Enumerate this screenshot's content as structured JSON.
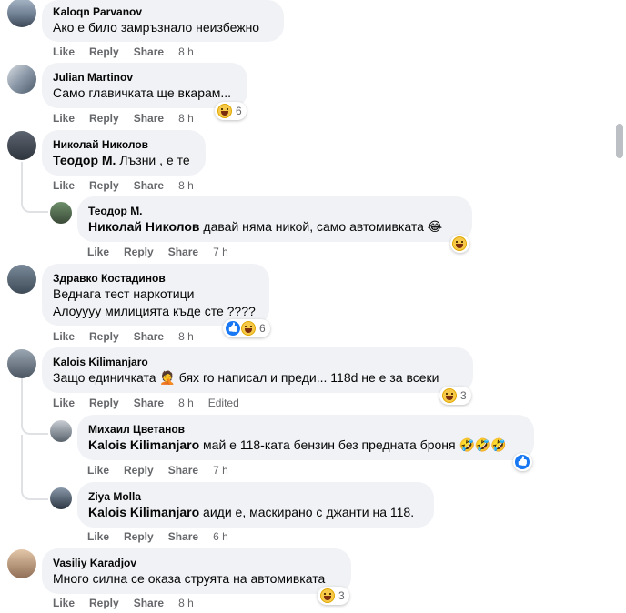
{
  "labels": {
    "like": "Like",
    "reply": "Reply",
    "share": "Share"
  },
  "comments": [
    {
      "author": "Kaloqn Parvanov",
      "text": "Ако е било замръзнало неизбежно",
      "time": "8 h"
    },
    {
      "author": "Julian Martinov",
      "text": "Само главичката ще вкарам...",
      "time": "8 h",
      "reactions": "6"
    },
    {
      "author": "Николай Николов",
      "mention": "Теодор М.",
      "text": " Лъзни , е те",
      "time": "8 h"
    },
    {
      "author": "Теодор М.",
      "mention": "Николай Николов",
      "text": " давай няма никой, само автомивката 😂",
      "time": "7 h"
    },
    {
      "author": "Здравко Костадинов",
      "text_line1": "Веднага тест наркотици",
      "text_line2": "Алоуууу милицията къде сте ????",
      "time": "8 h",
      "reactions": "6"
    },
    {
      "author": "Kalois Kilimanjaro",
      "text": "Защо единичката 🤦 бях го написал и преди... 118d не е за всеки",
      "time": "8 h",
      "edited": "Edited",
      "reactions": "3"
    },
    {
      "author": "Михаил Цветанов",
      "mention": "Kalois Kilimanjaro",
      "text": " май е 118-ката бензин без предната броня 🤣🤣🤣",
      "time": "7 h"
    },
    {
      "author": "Ziya Molla",
      "mention": "Kalois Kilimanjaro",
      "text": " аиди е, маскирано с джанти на 118.",
      "time": "6 h"
    },
    {
      "author": "Vasiliy Karadjov",
      "text": "Много силна се оказа струята на автомивката",
      "time": "8 h",
      "reactions": "3"
    }
  ],
  "colors": {
    "bubble": "#f0f2f5",
    "meta": "#65676b",
    "like_blue": "#1877f2",
    "haha": "#f7c948"
  },
  "icons": [
    "haha-reaction-icon",
    "like-reaction-icon"
  ]
}
